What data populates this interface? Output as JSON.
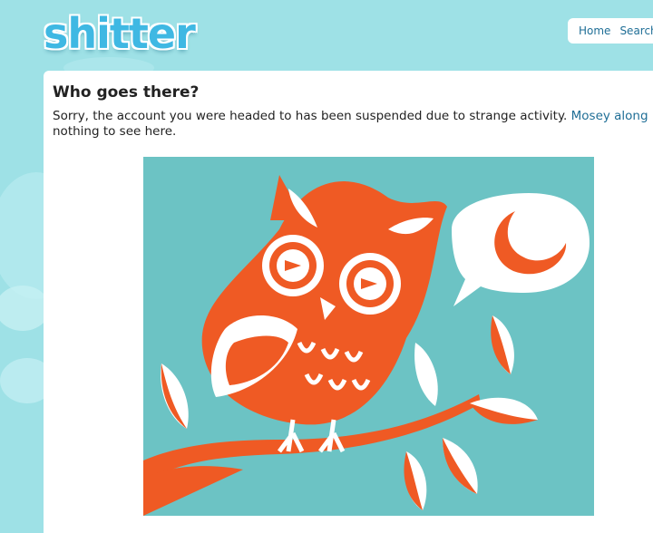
{
  "logo": {
    "text": "shitter"
  },
  "topnav": {
    "home": "Home",
    "search": "Search"
  },
  "main": {
    "title": "Who goes there?",
    "message_line1": "Sorry, the account you were headed to has been suspended due to strange activity. ",
    "link": "Mosey along now",
    "message_line2": "nothing to see here."
  },
  "illustration": {
    "subject": "owl-on-branch",
    "speech": "crescent-moon"
  },
  "colors": {
    "background": "#9ee1e6",
    "brand_blue": "#3fb8e3",
    "link": "#1f6e96",
    "owl_orange": "#ef5a24",
    "owl_bg": "#6cc3c4"
  }
}
